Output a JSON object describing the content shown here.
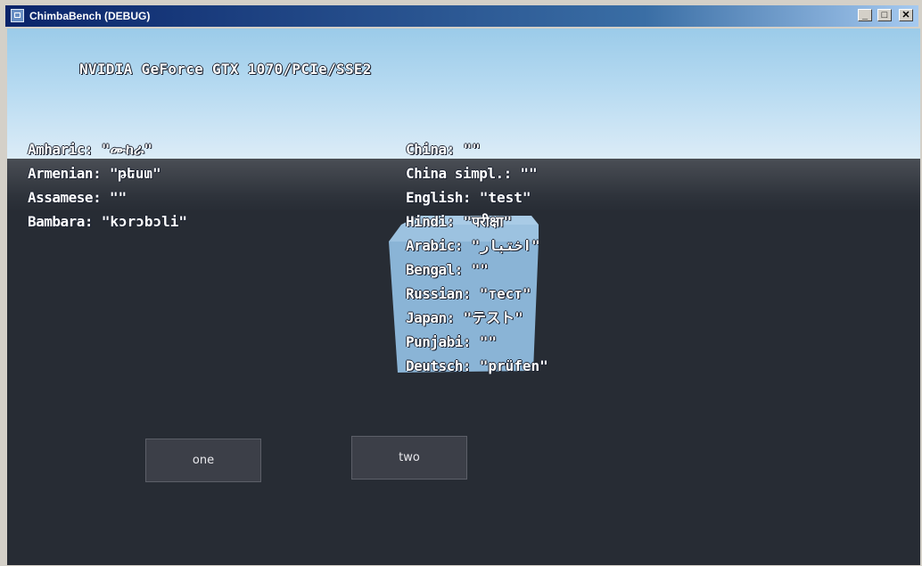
{
  "window": {
    "title": "ChimbaBench (DEBUG)",
    "controls": {
      "minimize": "_",
      "maximize": "□",
      "close": "✕"
    }
  },
  "scene": {
    "gpu_label": "NVIDIA GeForce GTX 1070/PCIe/SSE2",
    "colors": {
      "sky_top": "#9bcbe9",
      "sky_bottom": "#dcecf7",
      "ground": "#272c34",
      "cube": "#8ab4d6"
    }
  },
  "languages_left": [
    {
      "label": "Amharic:",
      "value": "\"ሙከራ\""
    },
    {
      "label": "Armenian:",
      "value": "\"թեստ\""
    },
    {
      "label": "Assamese:",
      "value": "\"\""
    },
    {
      "label": "Bambara:",
      "value": "\"kɔrɔbɔli\""
    }
  ],
  "languages_right": [
    {
      "label": "China:",
      "value": "\"\""
    },
    {
      "label": "China simpl.:",
      "value": "\"\""
    },
    {
      "label": "English:",
      "value": "\"test\""
    },
    {
      "label": "Hindi:",
      "value": "\"परीक्षा\""
    },
    {
      "label": "Arabic:",
      "value": "\"اختبار\""
    },
    {
      "label": "Bengal:",
      "value": "\"\""
    },
    {
      "label": "Russian:",
      "value": "\"тест\""
    },
    {
      "label": "Japan:",
      "value": "\"テスト\""
    },
    {
      "label": "Punjabi:",
      "value": "\"\""
    },
    {
      "label": "Deutsch:",
      "value": "\"prüfen\""
    }
  ],
  "buttons": {
    "one": "one",
    "two": "two"
  }
}
